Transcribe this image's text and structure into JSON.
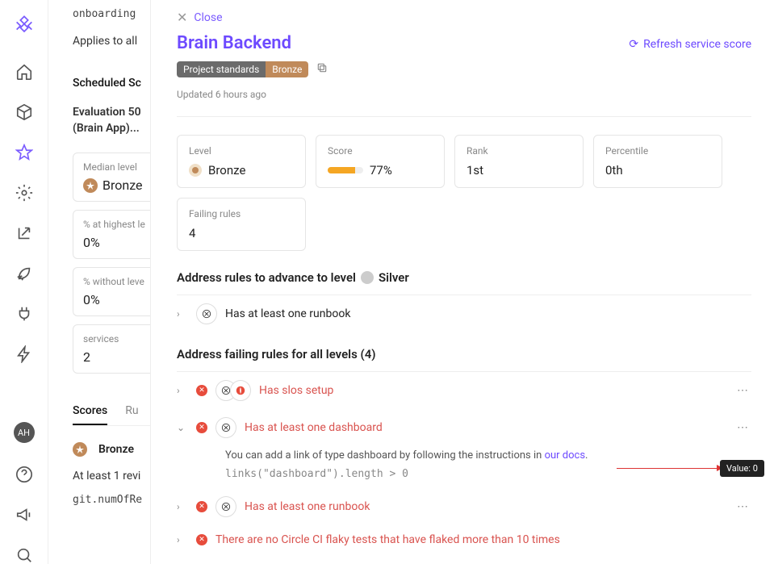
{
  "sidebar": {
    "avatar_initials": "AH"
  },
  "back": {
    "code_line": "onboarding",
    "applies": "Applies to all",
    "scheduled": "Scheduled Sc",
    "eval_title": "Evaluation 50",
    "eval_sub": "(Brain App)...",
    "stats": [
      {
        "label": "Median level",
        "value": "Bronze",
        "badge": true
      },
      {
        "label": "% at highest le",
        "value": "0%"
      },
      {
        "label": "% without leve",
        "value": "0%"
      },
      {
        "label": "services",
        "value": "2"
      }
    ],
    "tabs": [
      {
        "label": "Scores",
        "active": true
      },
      {
        "label": "Ru",
        "active": false
      }
    ],
    "rule_level": "Bronze",
    "rule_text": "At least 1 revi",
    "rule_code": "git.numOfRe"
  },
  "panel": {
    "close": "Close",
    "title": "Brain Backend",
    "refresh": "Refresh service score",
    "tag_left": "Project standards",
    "tag_right": "Bronze",
    "updated": "Updated 6 hours ago",
    "metrics": {
      "level_label": "Level",
      "level_value": "Bronze",
      "score_label": "Score",
      "score_value": "77%",
      "score_pct": 77,
      "rank_label": "Rank",
      "rank_value": "1st",
      "percentile_label": "Percentile",
      "percentile_value": "0th",
      "failing_label": "Failing rules",
      "failing_value": "4"
    },
    "advance_head": "Address rules to advance to level",
    "advance_level": "Silver",
    "advance_rule": "Has at least one runbook",
    "failing_head": "Address failing rules for all levels (4)",
    "failing_rules": [
      {
        "text": "Has slos setup",
        "expanded": false,
        "double_icon": true
      },
      {
        "text": "Has at least one dashboard",
        "expanded": true,
        "body_pre": "You can add a link of type dashboard by following the instructions in ",
        "body_link": "our docs",
        "body_post": ".",
        "code": "links(\"dashboard\").length > 0"
      },
      {
        "text": "Has at least one runbook",
        "expanded": false
      },
      {
        "text": "There are no Circle CI flaky tests that have flaked more than 10 times",
        "expanded": false,
        "no_icon": true
      }
    ],
    "tooltip": "Value: 0"
  }
}
